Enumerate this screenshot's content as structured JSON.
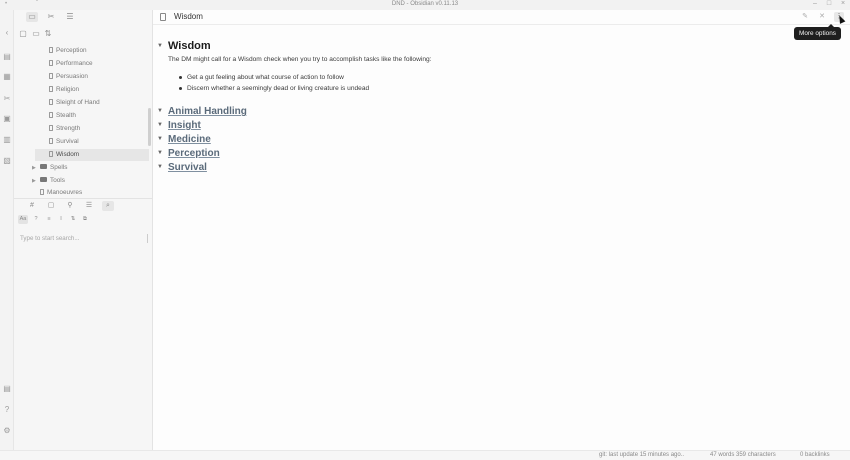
{
  "window": {
    "title": "DND - Obsidian v0.11.13",
    "controls": [
      "minimize",
      "maximize",
      "close"
    ]
  },
  "ribbon": {
    "icons": [
      "chevron-left-icon",
      "open-quick-switcher-icon",
      "graph-view-icon",
      "plugin-icon",
      "calendar-icon",
      "daily-note-icon",
      "template-icon",
      "vault-icon",
      "help-icon",
      "settings-icon"
    ]
  },
  "sidebar": {
    "top_tabs": [
      "file-explorer",
      "plugin",
      "outline"
    ],
    "nav_actions": [
      "new-note",
      "new-folder",
      "sort"
    ],
    "files": [
      {
        "name": "Perception",
        "type": "file",
        "depth": 2
      },
      {
        "name": "Performance",
        "type": "file",
        "depth": 2
      },
      {
        "name": "Persuasion",
        "type": "file",
        "depth": 2
      },
      {
        "name": "Religion",
        "type": "file",
        "depth": 2
      },
      {
        "name": "Sleight of Hand",
        "type": "file",
        "depth": 2
      },
      {
        "name": "Stealth",
        "type": "file",
        "depth": 2
      },
      {
        "name": "Strength",
        "type": "file",
        "depth": 2
      },
      {
        "name": "Survival",
        "type": "file",
        "depth": 2
      },
      {
        "name": "Wisdom",
        "type": "file",
        "depth": 2,
        "active": true
      },
      {
        "name": "Spells",
        "type": "folder",
        "depth": 1
      },
      {
        "name": "Tools",
        "type": "folder",
        "depth": 1
      },
      {
        "name": "Manoeuvres",
        "type": "file",
        "depth": 1
      }
    ],
    "pane_tabs": [
      "#",
      "file",
      "link",
      "list",
      "search"
    ],
    "search": {
      "options": [
        "Aa",
        "?",
        "≡",
        "I",
        "⇅",
        "⧉"
      ],
      "placeholder": "Type to start search..."
    }
  },
  "editor": {
    "tab_title": "Wisdom",
    "tooltip": "More options",
    "heading": "Wisdom",
    "paragraph": "The DM might call for a Wisdom check when you try to accomplish tasks like the following:",
    "bullets": [
      "Get a gut feeling about what course of action to follow",
      "Discern whether a seemingly dead or living creature is undead"
    ],
    "links": [
      "Animal Handling",
      "Insight",
      "Medicine",
      "Perception",
      "Survival"
    ]
  },
  "status": {
    "git": "git: last update 15 minutes ago..",
    "counts": "47 words 359 characters",
    "backlinks": "0 backlinks"
  },
  "colors": {
    "accent": "#5a6a7a",
    "tooltip_bg": "#1e1e1e"
  }
}
